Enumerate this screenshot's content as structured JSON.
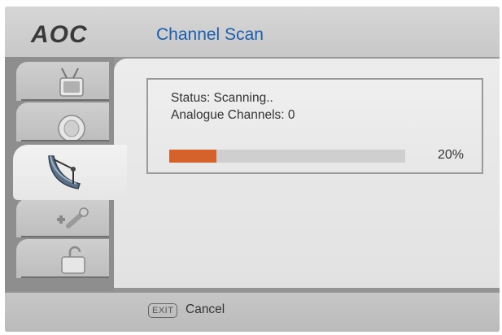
{
  "header": {
    "brand": "AOC",
    "title": "Channel Scan"
  },
  "sidebar": {
    "tabs": [
      {
        "icon": "tv-picture-icon",
        "active": false
      },
      {
        "icon": "speaker-sound-icon",
        "active": false
      },
      {
        "icon": "satellite-dish-icon",
        "active": true
      },
      {
        "icon": "tools-settings-icon",
        "active": false
      },
      {
        "icon": "lock-icon",
        "active": false
      }
    ]
  },
  "scan": {
    "status": "Status: Scanning..",
    "channels": "Analogue Channels: 0",
    "progress_value": 0.2,
    "progress_label": "20%"
  },
  "footer": {
    "exit_key": "EXIT",
    "cancel_label": "Cancel"
  },
  "colors": {
    "accent_title": "#1a5fae",
    "progress_fill": "#d4622a",
    "progress_track": "#cfcfcf"
  }
}
